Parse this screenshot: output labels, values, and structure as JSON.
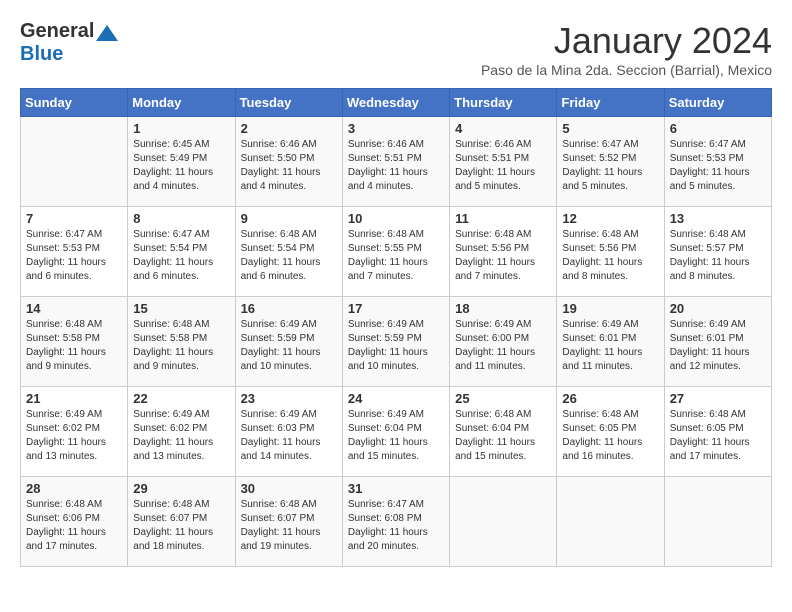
{
  "header": {
    "logo_general": "General",
    "logo_blue": "Blue",
    "month_title": "January 2024",
    "subtitle": "Paso de la Mina 2da. Seccion (Barrial), Mexico"
  },
  "days_of_week": [
    "Sunday",
    "Monday",
    "Tuesday",
    "Wednesday",
    "Thursday",
    "Friday",
    "Saturday"
  ],
  "weeks": [
    [
      {
        "day": "",
        "info": ""
      },
      {
        "day": "1",
        "info": "Sunrise: 6:45 AM\nSunset: 5:49 PM\nDaylight: 11 hours\nand 4 minutes."
      },
      {
        "day": "2",
        "info": "Sunrise: 6:46 AM\nSunset: 5:50 PM\nDaylight: 11 hours\nand 4 minutes."
      },
      {
        "day": "3",
        "info": "Sunrise: 6:46 AM\nSunset: 5:51 PM\nDaylight: 11 hours\nand 4 minutes."
      },
      {
        "day": "4",
        "info": "Sunrise: 6:46 AM\nSunset: 5:51 PM\nDaylight: 11 hours\nand 5 minutes."
      },
      {
        "day": "5",
        "info": "Sunrise: 6:47 AM\nSunset: 5:52 PM\nDaylight: 11 hours\nand 5 minutes."
      },
      {
        "day": "6",
        "info": "Sunrise: 6:47 AM\nSunset: 5:53 PM\nDaylight: 11 hours\nand 5 minutes."
      }
    ],
    [
      {
        "day": "7",
        "info": "Sunrise: 6:47 AM\nSunset: 5:53 PM\nDaylight: 11 hours\nand 6 minutes."
      },
      {
        "day": "8",
        "info": "Sunrise: 6:47 AM\nSunset: 5:54 PM\nDaylight: 11 hours\nand 6 minutes."
      },
      {
        "day": "9",
        "info": "Sunrise: 6:48 AM\nSunset: 5:54 PM\nDaylight: 11 hours\nand 6 minutes."
      },
      {
        "day": "10",
        "info": "Sunrise: 6:48 AM\nSunset: 5:55 PM\nDaylight: 11 hours\nand 7 minutes."
      },
      {
        "day": "11",
        "info": "Sunrise: 6:48 AM\nSunset: 5:56 PM\nDaylight: 11 hours\nand 7 minutes."
      },
      {
        "day": "12",
        "info": "Sunrise: 6:48 AM\nSunset: 5:56 PM\nDaylight: 11 hours\nand 8 minutes."
      },
      {
        "day": "13",
        "info": "Sunrise: 6:48 AM\nSunset: 5:57 PM\nDaylight: 11 hours\nand 8 minutes."
      }
    ],
    [
      {
        "day": "14",
        "info": "Sunrise: 6:48 AM\nSunset: 5:58 PM\nDaylight: 11 hours\nand 9 minutes."
      },
      {
        "day": "15",
        "info": "Sunrise: 6:48 AM\nSunset: 5:58 PM\nDaylight: 11 hours\nand 9 minutes."
      },
      {
        "day": "16",
        "info": "Sunrise: 6:49 AM\nSunset: 5:59 PM\nDaylight: 11 hours\nand 10 minutes."
      },
      {
        "day": "17",
        "info": "Sunrise: 6:49 AM\nSunset: 5:59 PM\nDaylight: 11 hours\nand 10 minutes."
      },
      {
        "day": "18",
        "info": "Sunrise: 6:49 AM\nSunset: 6:00 PM\nDaylight: 11 hours\nand 11 minutes."
      },
      {
        "day": "19",
        "info": "Sunrise: 6:49 AM\nSunset: 6:01 PM\nDaylight: 11 hours\nand 11 minutes."
      },
      {
        "day": "20",
        "info": "Sunrise: 6:49 AM\nSunset: 6:01 PM\nDaylight: 11 hours\nand 12 minutes."
      }
    ],
    [
      {
        "day": "21",
        "info": "Sunrise: 6:49 AM\nSunset: 6:02 PM\nDaylight: 11 hours\nand 13 minutes."
      },
      {
        "day": "22",
        "info": "Sunrise: 6:49 AM\nSunset: 6:02 PM\nDaylight: 11 hours\nand 13 minutes."
      },
      {
        "day": "23",
        "info": "Sunrise: 6:49 AM\nSunset: 6:03 PM\nDaylight: 11 hours\nand 14 minutes."
      },
      {
        "day": "24",
        "info": "Sunrise: 6:49 AM\nSunset: 6:04 PM\nDaylight: 11 hours\nand 15 minutes."
      },
      {
        "day": "25",
        "info": "Sunrise: 6:48 AM\nSunset: 6:04 PM\nDaylight: 11 hours\nand 15 minutes."
      },
      {
        "day": "26",
        "info": "Sunrise: 6:48 AM\nSunset: 6:05 PM\nDaylight: 11 hours\nand 16 minutes."
      },
      {
        "day": "27",
        "info": "Sunrise: 6:48 AM\nSunset: 6:05 PM\nDaylight: 11 hours\nand 17 minutes."
      }
    ],
    [
      {
        "day": "28",
        "info": "Sunrise: 6:48 AM\nSunset: 6:06 PM\nDaylight: 11 hours\nand 17 minutes."
      },
      {
        "day": "29",
        "info": "Sunrise: 6:48 AM\nSunset: 6:07 PM\nDaylight: 11 hours\nand 18 minutes."
      },
      {
        "day": "30",
        "info": "Sunrise: 6:48 AM\nSunset: 6:07 PM\nDaylight: 11 hours\nand 19 minutes."
      },
      {
        "day": "31",
        "info": "Sunrise: 6:47 AM\nSunset: 6:08 PM\nDaylight: 11 hours\nand 20 minutes."
      },
      {
        "day": "",
        "info": ""
      },
      {
        "day": "",
        "info": ""
      },
      {
        "day": "",
        "info": ""
      }
    ]
  ]
}
